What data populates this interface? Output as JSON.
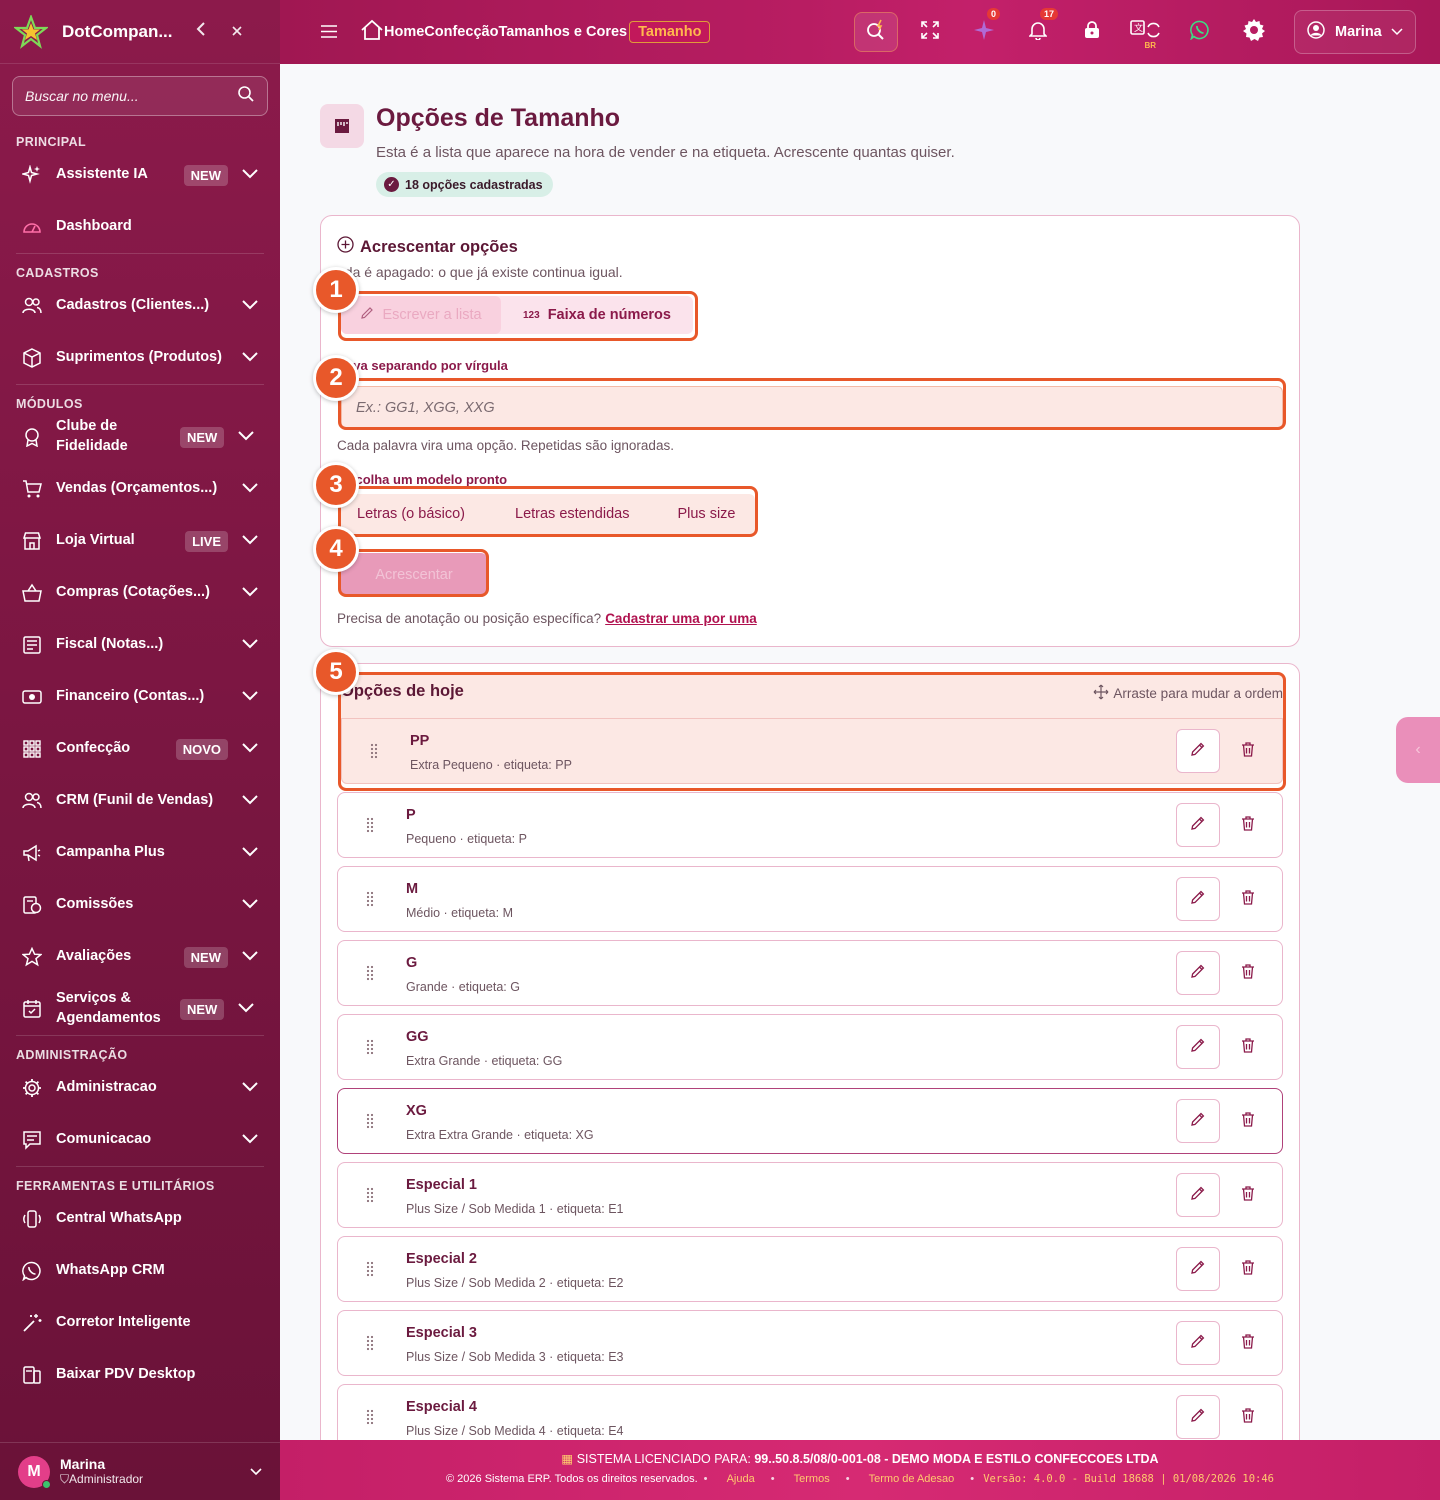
{
  "app": {
    "brand": "DotCompan..."
  },
  "sidebar": {
    "search_placeholder": "Buscar no menu...",
    "sections": {
      "principal": "PRINCIPAL",
      "cadastros": "CADASTROS",
      "modulos": "MÓDULOS",
      "administracao": "ADMINISTRAÇÃO",
      "ferramentas": "FERRAMENTAS E UTILITÁRIOS"
    },
    "items": {
      "assistente": {
        "label": "Assistente IA",
        "badge": "NEW"
      },
      "dashboard": {
        "label": "Dashboard"
      },
      "cadastros": {
        "label": "Cadastros (Clientes...)"
      },
      "suprimentos": {
        "label": "Suprimentos (Produtos)"
      },
      "clube": {
        "label": "Clube de Fidelidade",
        "badge": "NEW"
      },
      "vendas": {
        "label": "Vendas (Orçamentos...)"
      },
      "loja": {
        "label": "Loja Virtual",
        "badge": "LIVE"
      },
      "compras": {
        "label": "Compras (Cotações...)"
      },
      "fiscal": {
        "label": "Fiscal (Notas...)"
      },
      "financeiro": {
        "label": "Financeiro (Contas...)"
      },
      "confeccao": {
        "label": "Confecção",
        "badge": "NOVO"
      },
      "crm": {
        "label": "CRM (Funil de Vendas)"
      },
      "campanha": {
        "label": "Campanha Plus"
      },
      "comissoes": {
        "label": "Comissões"
      },
      "avaliacoes": {
        "label": "Avaliações",
        "badge": "NEW"
      },
      "servicos": {
        "label": "Serviços & Agendamentos",
        "badge": "NEW"
      },
      "administracao": {
        "label": "Administracao"
      },
      "comunicacao": {
        "label": "Comunicacao"
      },
      "central_whatsapp": {
        "label": "Central WhatsApp"
      },
      "whatsapp_crm": {
        "label": "WhatsApp CRM"
      },
      "corretor": {
        "label": "Corretor Inteligente"
      },
      "pdv": {
        "label": "Baixar PDV Desktop"
      }
    },
    "user": {
      "initial": "M",
      "name": "Marina",
      "role": "Administrador"
    }
  },
  "topbar": {
    "breadcrumb": {
      "home": "Home",
      "c1": "Confecção",
      "c2": "Tamanhos e Cores",
      "current": "Tamanho"
    },
    "ai_count": "0",
    "notif_count": "17",
    "lang": "BR",
    "user": "Marina"
  },
  "page": {
    "title": "Opções de Tamanho",
    "subtitle": "Esta é a lista que aparece na hora de vender e na etiqueta. Acrescente quantas quiser.",
    "count": "18 opções cadastradas"
  },
  "add_card": {
    "title": "Acrescentar opções",
    "note": "ada é apagado: o que já existe continua igual.",
    "tab_write": "Escrever a lista",
    "tab_range_num": "123",
    "tab_range": "Faixa de números",
    "input_label": "reva separando por vírgula",
    "input_placeholder": "Ex.: GG1, XGG, XXG",
    "input_hint": "Cada palavra vira uma opção. Repetidas são ignoradas.",
    "models_label": "escolha um modelo pronto",
    "models": [
      "Letras (o básico)",
      "Letras estendidas",
      "Plus size"
    ],
    "add_button": "Acrescentar",
    "footer_text": "Precisa de anotação ou posição específica?",
    "footer_link": "Cadastrar uma por uma"
  },
  "options_card": {
    "title": "Opções de hoje",
    "drag_hint": "Arraste para mudar a ordem",
    "items": [
      {
        "name": "PP",
        "desc": "Extra Pequeno · etiqueta: PP"
      },
      {
        "name": "P",
        "desc": "Pequeno · etiqueta: P"
      },
      {
        "name": "M",
        "desc": "Médio · etiqueta: M"
      },
      {
        "name": "G",
        "desc": "Grande · etiqueta: G"
      },
      {
        "name": "GG",
        "desc": "Extra Grande · etiqueta: GG"
      },
      {
        "name": "XG",
        "desc": "Extra Extra Grande · etiqueta: XG"
      },
      {
        "name": "Especial 1",
        "desc": "Plus Size / Sob Medida 1 · etiqueta: E1"
      },
      {
        "name": "Especial 2",
        "desc": "Plus Size / Sob Medida 2 · etiqueta: E2"
      },
      {
        "name": "Especial 3",
        "desc": "Plus Size / Sob Medida 3 · etiqueta: E3"
      },
      {
        "name": "Especial 4",
        "desc": "Plus Size / Sob Medida 4 · etiqueta: E4"
      }
    ]
  },
  "tour_steps": [
    "1",
    "2",
    "3",
    "4",
    "5"
  ],
  "footer": {
    "license_prefix": "SISTEMA LICENCIADO PARA:",
    "license_value": "99..50.8.5/08/0-001-08 - DEMO MODA E ESTILO CONFECCOES LTDA",
    "copyright": "© 2026 Sistema ERP. Todos os direitos reservados.",
    "links": [
      "Ajuda",
      "Termos",
      "Termo de Adesao"
    ],
    "version": "Versão: 4.0.0 - Build 18688 | 01/08/2026 10:46"
  },
  "colors": {
    "brand": "#8c1a4b",
    "accent": "#c2185b",
    "tour": "#e8582a"
  }
}
